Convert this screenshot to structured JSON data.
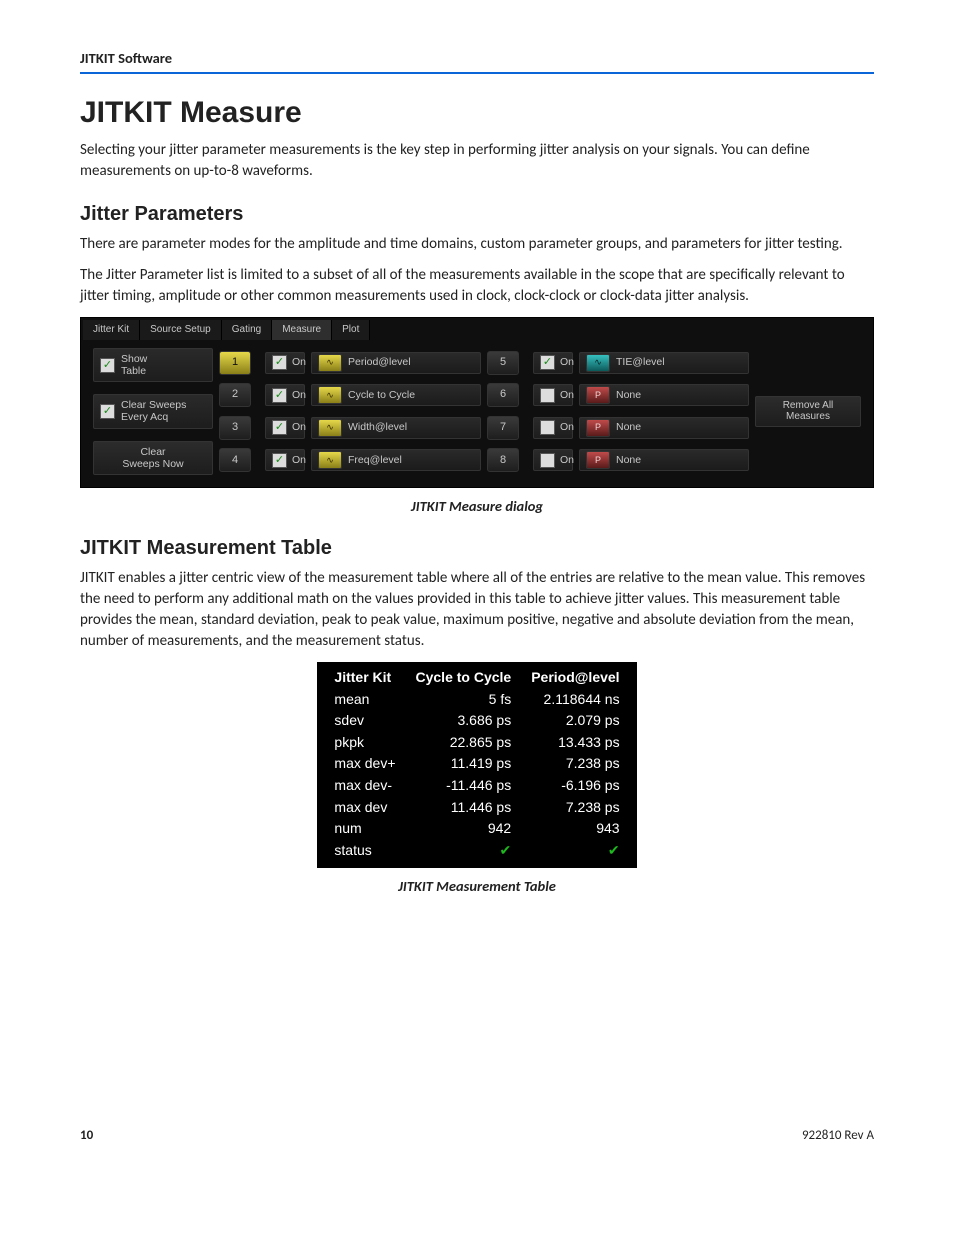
{
  "running_head": "JITKIT Software",
  "h1": "JITKIT Measure",
  "p1": "Selecting your jitter parameter measurements is the key step in performing jitter analysis on your signals. You can define measurements on up-to-8 waveforms.",
  "h2a": "Jitter Parameters",
  "p2": "There are parameter modes for the amplitude and time domains, custom parameter groups, and parameters for jitter testing.",
  "p3": "The Jitter Parameter list is limited to a subset of all of the measurements available in the scope that are specifically relevant to jitter timing, amplitude or other common measurements used in clock, clock-clock or clock-data jitter analysis.",
  "caption1": "JITKIT Measure dialog",
  "h2b": "JITKIT Measurement Table",
  "p4": "JITKIT enables a jitter centric view of the measurement table where all of the entries are relative to the mean value. This removes the need to perform any additional math on the values provided in this table to achieve jitter values. This measurement table provides the mean, standard deviation, peak to peak value, maximum positive, negative and absolute deviation from the mean, number of measurements, and the measurement status.",
  "caption2": "JITKIT Measurement Table",
  "footer": {
    "page": "10",
    "doc_id": "922810 Rev A"
  },
  "dlg": {
    "tabs": [
      "Jitter Kit",
      "Source Setup",
      "Gating",
      "Measure",
      "Plot"
    ],
    "active_tab": 3,
    "show_table": "Show\nTable",
    "clear_sweeps_every": "Clear Sweeps\nEvery Acq",
    "clear_sweeps_now": "Clear\nSweeps Now",
    "on_label": "On",
    "remove_all": "Remove All\nMeasures",
    "rows": [
      {
        "num": "1",
        "on": true,
        "label": "Period@level",
        "ico": "y",
        "num2": "5",
        "on2": true,
        "label2": "TIE@level",
        "ico2": "c"
      },
      {
        "num": "2",
        "on": true,
        "label": "Cycle to Cycle",
        "ico": "y",
        "num2": "6",
        "on2": false,
        "label2": "None",
        "ico2": "r"
      },
      {
        "num": "3",
        "on": true,
        "label": "Width@level",
        "ico": "y",
        "num2": "7",
        "on2": false,
        "label2": "None",
        "ico2": "r"
      },
      {
        "num": "4",
        "on": true,
        "label": "Freq@level",
        "ico": "y",
        "num2": "8",
        "on2": false,
        "label2": "None",
        "ico2": "r"
      }
    ]
  },
  "table": {
    "headers": [
      "Jitter Kit",
      "Cycle to Cycle",
      "Period@level"
    ],
    "rows": [
      [
        "mean",
        "5 fs",
        "2.118644 ns"
      ],
      [
        "sdev",
        "3.686 ps",
        "2.079 ps"
      ],
      [
        "pkpk",
        "22.865 ps",
        "13.433 ps"
      ],
      [
        "max dev+",
        "11.419 ps",
        "7.238 ps"
      ],
      [
        "max dev-",
        "-11.446 ps",
        "-6.196 ps"
      ],
      [
        "max dev",
        "11.446 ps",
        "7.238 ps"
      ],
      [
        "num",
        "942",
        "943"
      ]
    ],
    "status_label": "status"
  }
}
